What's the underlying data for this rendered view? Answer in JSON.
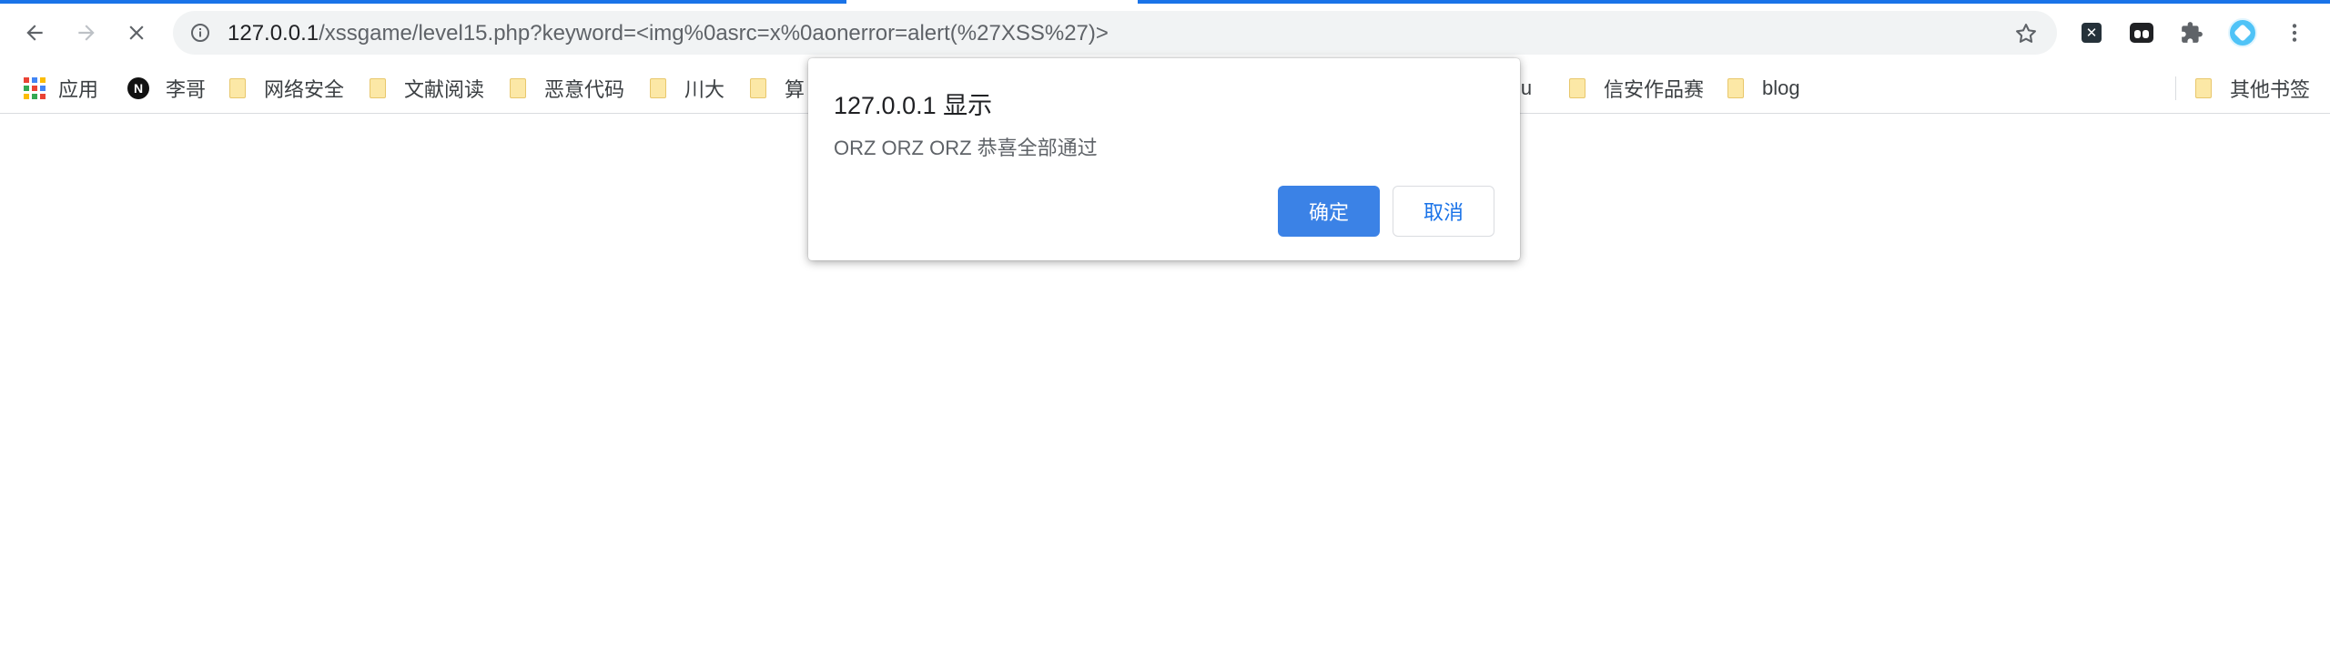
{
  "browser": {
    "url_host": "127.0.0.1",
    "url_path": "/xssgame/level15.php?keyword=<img%0asrc=x%0aonerror=alert(%27XSS%27)>",
    "accent_color": "#1a73e8",
    "icons": [
      "back-arrow-icon",
      "forward-arrow-icon",
      "stop-loading-icon",
      "info-icon",
      "star-icon",
      "extension-x-icon",
      "tampermonkey-icon",
      "puzzle-extensions-icon",
      "profile-avatar-icon",
      "more-menu-icon"
    ]
  },
  "bookmarks": {
    "apps_label": "应用",
    "items": [
      {
        "label": "李哥",
        "icon": "n-logo-icon"
      },
      {
        "label": "网络安全",
        "icon": "folder-icon"
      },
      {
        "label": "文献阅读",
        "icon": "folder-icon"
      },
      {
        "label": "恶意代码",
        "icon": "folder-icon"
      },
      {
        "label": "川大",
        "icon": "folder-icon"
      },
      {
        "label": "算",
        "icon": "folder-icon"
      },
      {
        "label": "iu",
        "icon": ""
      },
      {
        "label": "信安作品赛",
        "icon": "folder-icon"
      },
      {
        "label": "blog",
        "icon": "folder-icon"
      }
    ],
    "other_label": "其他书签"
  },
  "dialog": {
    "title": "127.0.0.1 显示",
    "message": "ORZ ORZ ORZ 恭喜全部通过",
    "ok_label": "确定",
    "cancel_label": "取消",
    "ok_color": "#3b82e6"
  }
}
